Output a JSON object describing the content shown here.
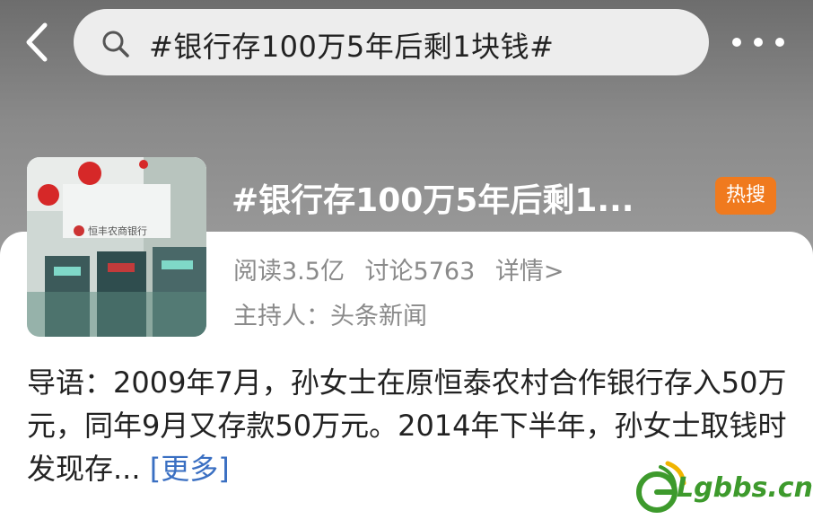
{
  "search": {
    "query": "#银行存100万5年后剩1块钱#"
  },
  "topic": {
    "title": "#银行存100万5年后剩1...",
    "hot_badge": "热搜",
    "reads": "阅读3.5亿",
    "discussions": "讨论5763",
    "details_link": "详情>",
    "host": "主持人：头条新闻",
    "thumbnail_sign": "恒丰农商银行"
  },
  "intro": {
    "text": "导语：2009年7月，孙女士在原恒泰农村合作银行存入50万元，同年9月又存款50万元。2014年下半年，孙女士取钱时发现存...",
    "more": "[更多]"
  },
  "watermark": {
    "text": "Lgbbs.cn"
  },
  "colors": {
    "hot_badge": "#f07a1e",
    "link": "#3a6fc2",
    "watermark_green": "#3d9a2c"
  }
}
